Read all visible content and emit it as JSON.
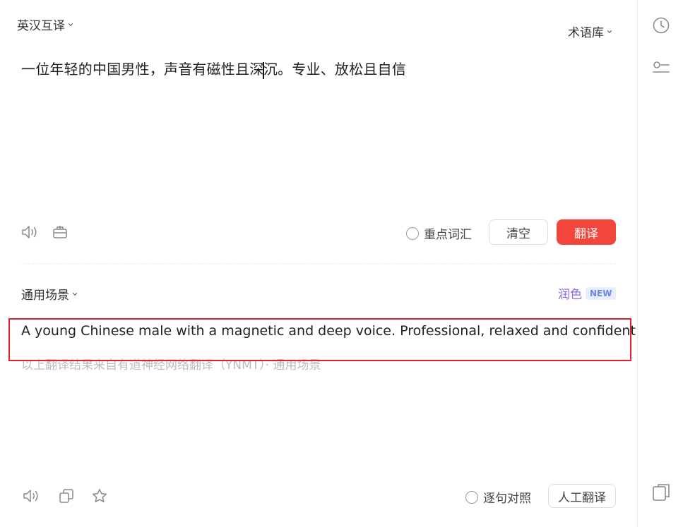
{
  "source": {
    "language_selector": "英汉互译",
    "glossary_selector": "术语库",
    "text_before_caret": "一位年轻的中国男性，声音有磁性且深",
    "text_after_caret": "沉。专业、放松且自信",
    "key_vocab_label": "重点词汇",
    "clear_label": "清空",
    "translate_label": "翻译"
  },
  "result": {
    "scene_selector": "通用场景",
    "polish_label": "润色",
    "polish_badge": "NEW",
    "translation": "A young Chinese male with a magnetic and deep voice. Professional, relaxed and confident",
    "source_note": "以上翻译结果来自有道神经网络翻译（YNMT）· 通用场景",
    "sentence_compare_label": "逐句对照",
    "human_translation_label": "人工翻译"
  },
  "icons": {
    "source_speaker": "speaker-icon",
    "source_toolbox": "toolbox-icon",
    "result_speaker": "speaker-icon",
    "copy": "copy-icon",
    "favorite": "star-icon",
    "history": "clock-icon",
    "settings": "settings-icon",
    "layout": "layout-icon"
  },
  "colors": {
    "accent_red": "#f2453b",
    "polish_purple": "#8f6af0",
    "highlight_red": "#e0202a"
  }
}
